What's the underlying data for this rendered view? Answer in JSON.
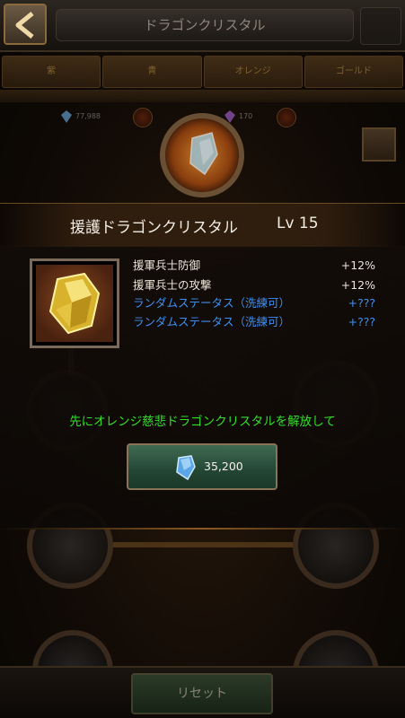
{
  "header": {
    "title": "ドラゴンクリスタル",
    "back_icon": "chevron-left-icon"
  },
  "tabs": [
    {
      "label": "紫"
    },
    {
      "label": "青"
    },
    {
      "label": "オレンジ"
    },
    {
      "label": "ゴールド"
    }
  ],
  "resources": {
    "blue_crystal": "77,988",
    "purple_crystal": "170"
  },
  "crystal": {
    "name": "援護ドラゴンクリスタル",
    "level": "Lv 15",
    "icon": "yellow-crystal-icon",
    "stats": [
      {
        "label": "援軍兵士防御",
        "value": "+12%",
        "kind": "fixed"
      },
      {
        "label": "援軍兵士の攻撃",
        "value": "+12%",
        "kind": "fixed"
      },
      {
        "label": "ランダムステータス（洗練可）",
        "value": "+???",
        "kind": "random"
      },
      {
        "label": "ランダムステータス（洗練可）",
        "value": "+???",
        "kind": "random"
      }
    ]
  },
  "hint": "先にオレンジ慈悲ドラゴンクリスタルを解放して",
  "unlock": {
    "cost": "35,200",
    "icon": "blue-crystal-icon"
  },
  "reset": {
    "label": "リセット"
  },
  "colors": {
    "hint": "#33e02a",
    "random_stat": "#3f8ff0",
    "accent": "#e0a94a"
  }
}
